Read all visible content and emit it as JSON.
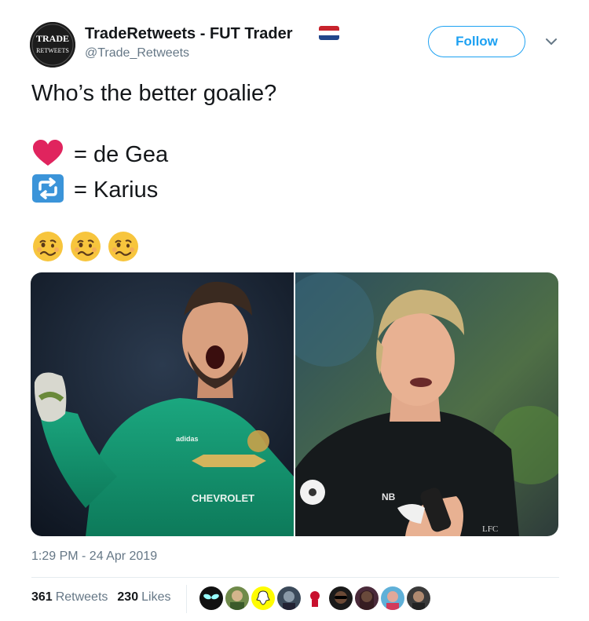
{
  "tweet": {
    "display_name": "TradeRetweets - FUT Trader",
    "handle": "@Trade_Retweets",
    "avatar_text_top": "TRADE",
    "avatar_text_bottom": "RETWEETS",
    "flag_icon": "netherlands-flag-icon",
    "follow_label": "Follow",
    "text_line1": "Who’s the better goalie?",
    "option_heart_label": "= de Gea",
    "option_retweet_label": "= Karius",
    "emoji_icons": [
      "woozy-face-icon",
      "woozy-face-icon",
      "woozy-face-icon"
    ],
    "image_left_shirt_text": "CHEVROLET",
    "image_right_shirt_text": "LFC",
    "timestamp": "1:29 PM - 24 Apr 2019",
    "retweets_count": "361",
    "retweets_label": "Retweets",
    "likes_count": "230",
    "likes_label": "Likes",
    "colors": {
      "accent": "#1da1f2",
      "heart": "#e0245e",
      "retweet_bg": "#3b94d9"
    }
  }
}
